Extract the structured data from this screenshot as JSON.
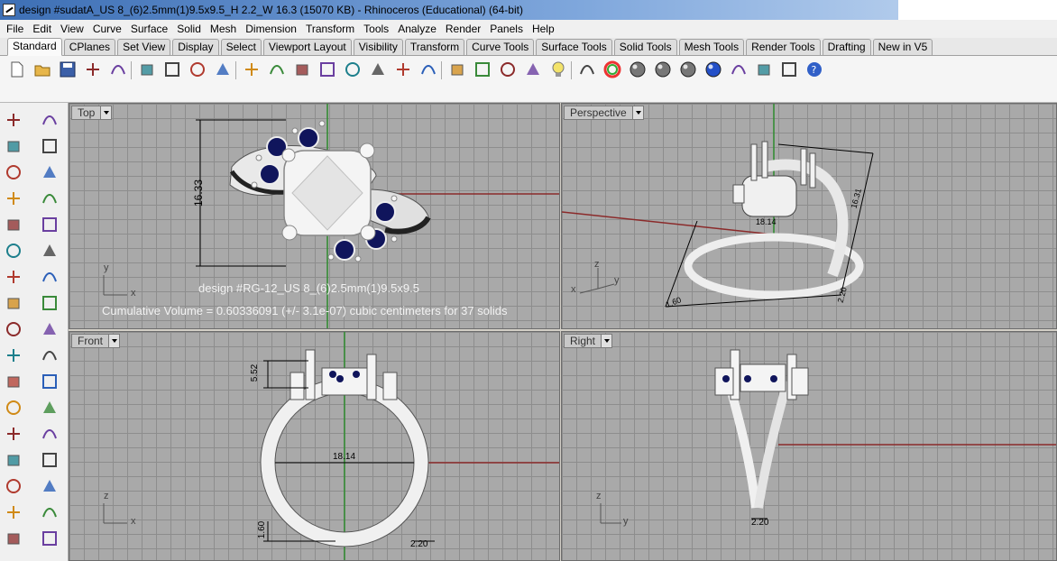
{
  "window": {
    "title": "design #sudatA_US 8_(6)2.5mm(1)9.5x9.5_H 2.2_W 16.3 (15070 KB) - Rhinoceros (Educational) (64-bit)"
  },
  "menu": [
    "File",
    "Edit",
    "View",
    "Curve",
    "Surface",
    "Solid",
    "Mesh",
    "Dimension",
    "Transform",
    "Tools",
    "Analyze",
    "Render",
    "Panels",
    "Help"
  ],
  "tabs": [
    "Standard",
    "CPlanes",
    "Set View",
    "Display",
    "Select",
    "Viewport Layout",
    "Visibility",
    "Transform",
    "Curve Tools",
    "Surface Tools",
    "Solid Tools",
    "Mesh Tools",
    "Render Tools",
    "Drafting",
    "New in V5"
  ],
  "active_tab": "Standard",
  "toolbar_icons": [
    "new-file-icon",
    "open-folder-icon",
    "save-icon",
    "print-icon",
    "import-icon",
    "cut-icon",
    "copy-icon",
    "paste-icon",
    "undo-icon",
    "pan-hand-icon",
    "move-view-icon",
    "zoom-dynamic-icon",
    "zoom-window-icon",
    "zoom-extents-icon",
    "zoom-selected-icon",
    "rotate-view-icon",
    "four-viewports-icon",
    "car-icon",
    "set-cplane-icon",
    "cplane-views-icon",
    "grid-icon",
    "light-bulb-icon",
    "layer-icon",
    "color-wheel-icon",
    "shaded-sphere-icon",
    "rendered-sphere-icon",
    "render-sphere-icon",
    "blue-sphere-icon",
    "lasso-select-icon",
    "pencil-icon",
    "object-snap-icon",
    "help-icon"
  ],
  "left_tools": [
    "select-arrow-icon",
    "point-icon",
    "polyline-icon",
    "curve-points-icon",
    "circle-icon",
    "circle-point-icon",
    "polygon-icon",
    "rectangle-icon",
    "ellipse-icon",
    "fillet-curve-icon",
    "surface-icon",
    "revolve-icon",
    "solid-box-icon",
    "solid-union-icon",
    "cylinder-icon",
    "mesh-icon",
    "explode-icon",
    "split-icon",
    "trim-icon",
    "array-icon",
    "join-icon",
    "boolean-icon",
    "text-icon",
    "move-icon",
    "group-icon",
    "scale-icon",
    "block-icon",
    "dimension-icon",
    "grid-snap-icon",
    "layer-stack-icon",
    "analyze-icon",
    "check-icon",
    "curvature-icon",
    "properties-icon"
  ],
  "viewports": {
    "top": {
      "label": "Top",
      "dim_height": "16.33",
      "note_title": "design #RG-12_US 8_(6)2.5mm(1)9.5x9.5",
      "note_volume": "Cumulative Volume = 0.60336091 (+/- 3.1e-07) cubic centimeters for 37 solids",
      "axis_y": "y",
      "axis_x": "x"
    },
    "perspective": {
      "label": "Perspective",
      "dim_a": "16.31",
      "dim_b": "18.14",
      "dim_c": "1.60",
      "dim_d": "2.20",
      "axis_z": "z",
      "axis_x": "x",
      "axis_y": "y"
    },
    "front": {
      "label": "Front",
      "dim_a": "5.52",
      "dim_b": "18.14",
      "dim_c": "1.60",
      "dim_d": "2.20",
      "axis_z": "z",
      "axis_x": "x"
    },
    "right": {
      "label": "Right",
      "dim_a": "2.20",
      "axis_z": "z",
      "axis_y": "y"
    }
  },
  "colors": {
    "viewport_bg": "#a9a9a9",
    "grid_line": "#8d8d8d",
    "x_axis": "#8b2a2a",
    "y_axis": "#2e8b2e",
    "gem": "#10155c",
    "metal": "#f3f3f3"
  }
}
